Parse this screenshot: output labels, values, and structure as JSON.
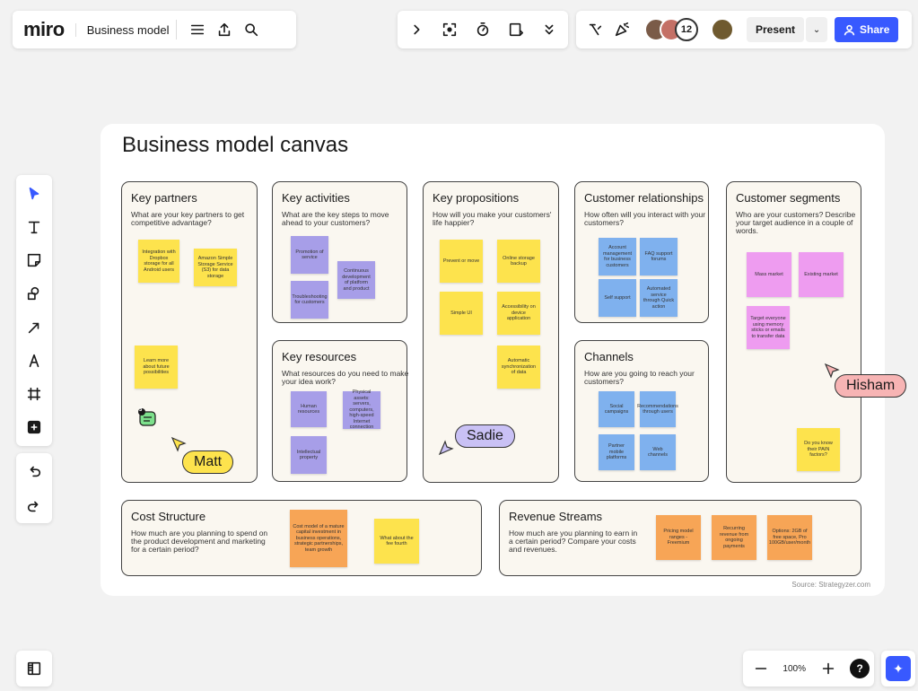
{
  "app": {
    "logo": "miro",
    "board_name": "Business model"
  },
  "collab": {
    "count": "12"
  },
  "buttons": {
    "present": "Present",
    "share": "Share"
  },
  "zoom": {
    "value": "100%",
    "help": "?"
  },
  "frame": {
    "title": "Business model canvas",
    "source": "Source: Strategyzer.com"
  },
  "sections": {
    "key_partners": {
      "title": "Key partners",
      "desc": "What are your key partners to get competitive advantage?"
    },
    "key_activities": {
      "title": "Key activities",
      "desc": "What are the key steps to move ahead to your customers?"
    },
    "key_resources": {
      "title": "Key resources",
      "desc": "What resources do you need to make your idea work?"
    },
    "key_propositions": {
      "title": "Key propositions",
      "desc": "How will you make your customers' life happier?"
    },
    "customer_relationships": {
      "title": "Customer relationships",
      "desc": "How often will you interact with your customers?"
    },
    "channels": {
      "title": "Channels",
      "desc": "How are you going to reach your customers?"
    },
    "customer_segments": {
      "title": "Customer segments",
      "desc": "Who are your customers? Describe your target audience in a couple of words."
    },
    "cost_structure": {
      "title": "Cost Structure",
      "desc": "How much are you planning to spend on the product development and marketing for a certain period?"
    },
    "revenue_streams": {
      "title": "Revenue Streams",
      "desc": "How much are you planning to earn in a certain period? Compare your costs and revenues."
    }
  },
  "notes": {
    "kp1": "Integration with Dropbox storage for all Android users",
    "kp2": "Amazon Simple Storage Service (S3) for data storage",
    "kp3": "Learn more about future possibilities",
    "ka1": "Promotion of service",
    "ka2": "Continuous development of platform and product",
    "ka3": "Troubleshooting for customers",
    "kr1": "Human resources",
    "kr2": "Physical assets: servers, computers, high-speed Internet connection",
    "kr3": "Intellectual property",
    "kpr1": "Prevent or move",
    "kpr2": "Online storage backup",
    "kpr3": "Simple UI",
    "kpr4": "Accessibility on device application",
    "kpr5": "Automatic synchronization of data",
    "cr1": "Account management for business customers",
    "cr2": "FAQ support forums",
    "cr3": "Self support",
    "cr4": "Automated service through Quick action",
    "ch1": "Social campaigns",
    "ch2": "Recommendations through users",
    "ch3": "Partner mobile platforms",
    "ch4": "Web channels",
    "cs1": "Mass market",
    "cs2": "Existing market",
    "cs3": "Target everyone using memory sticks or emails to transfer data",
    "cs4": "Do you know their PAIN factors?",
    "cst1": "Cost model of a mature capital investment in business operations, strategic partnerships, team growth",
    "cst2": "What about the fee fourth",
    "rs1": "Pricing model ranges - Freemium",
    "rs2": "Recurring revenue from ongoing payments",
    "rs3": "Options: 2GB of free space, Pro 100GB/user/month"
  },
  "cursors": {
    "matt": "Matt",
    "sadie": "Sadie",
    "hisham": "Hisham"
  },
  "comment_count": "3"
}
